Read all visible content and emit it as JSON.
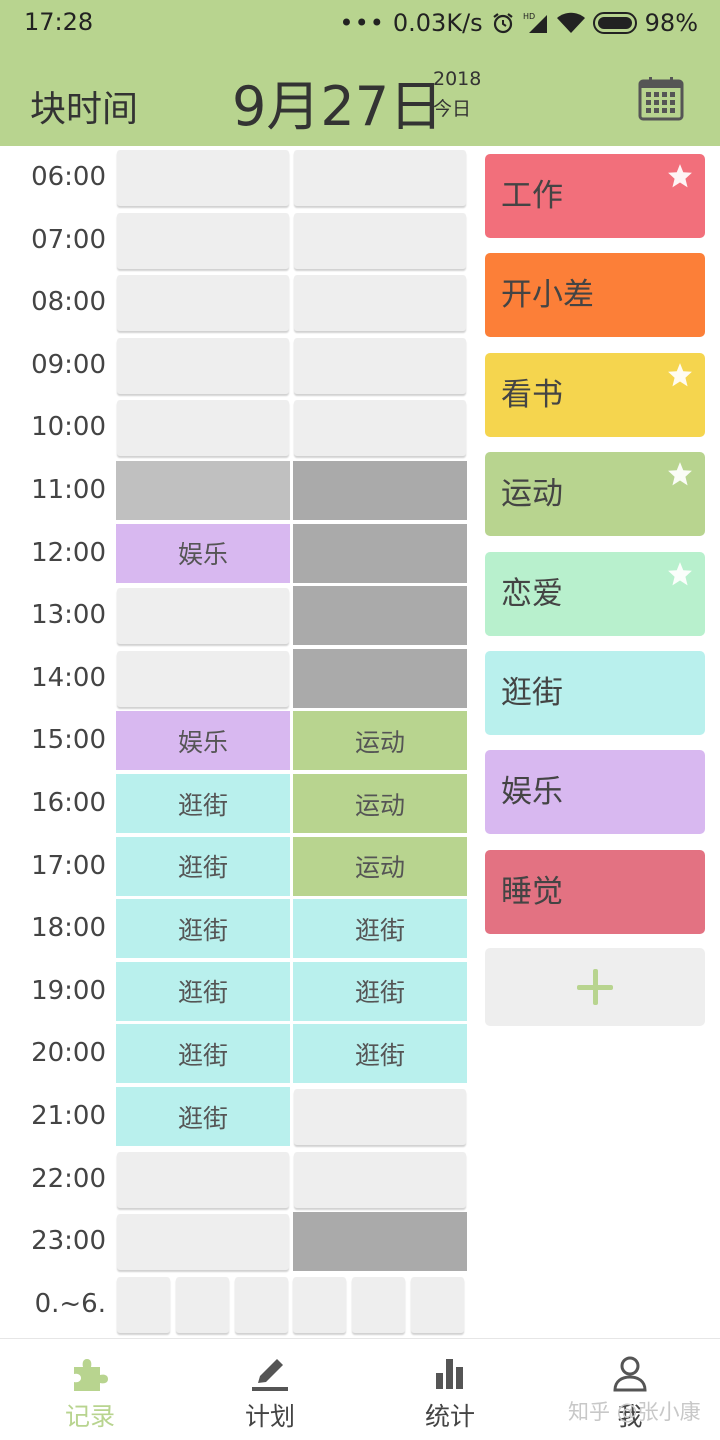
{
  "status_bar": {
    "time": "17:28",
    "dots": "•••",
    "net_speed": "0.03K/s",
    "battery": "98%",
    "icons": [
      "alarm-icon",
      "hd-signal-icon",
      "wifi-icon",
      "battery-icon"
    ]
  },
  "header": {
    "title": "块时间",
    "date": "9月27日",
    "year": "2018",
    "today": "今日",
    "calendar_icon": "calendar-icon"
  },
  "colors": {
    "theme_green": "#b8d48f",
    "empty": "#eeeeee",
    "blocked_light": "#c0c0c0",
    "blocked": "#aaaaaa",
    "work": "#f26f7b",
    "trip": "#fc7f38",
    "read": "#f5d54e",
    "sport": "#b8d48f",
    "love": "#b8f0cd",
    "shopping": "#b9f0ed",
    "fun": "#d8b8f0",
    "sleep": "#e37282"
  },
  "schedule": {
    "rows": [
      {
        "time": "06:00",
        "left": "",
        "right": ""
      },
      {
        "time": "07:00",
        "left": "",
        "right": ""
      },
      {
        "time": "08:00",
        "left": "",
        "right": ""
      },
      {
        "time": "09:00",
        "left": "",
        "right": ""
      },
      {
        "time": "10:00",
        "left": "",
        "right": ""
      },
      {
        "time": "11:00",
        "left": "",
        "right": ""
      },
      {
        "time": "12:00",
        "left": "娱乐",
        "right": ""
      },
      {
        "time": "13:00",
        "left": "",
        "right": ""
      },
      {
        "time": "14:00",
        "left": "",
        "right": ""
      },
      {
        "time": "15:00",
        "left": "娱乐",
        "right": "运动"
      },
      {
        "time": "16:00",
        "left": "逛街",
        "right": "运动"
      },
      {
        "time": "17:00",
        "left": "逛街",
        "right": "运动"
      },
      {
        "time": "18:00",
        "left": "逛街",
        "right": "逛街"
      },
      {
        "time": "19:00",
        "left": "逛街",
        "right": "逛街"
      },
      {
        "time": "20:00",
        "left": "逛街",
        "right": "逛街"
      },
      {
        "time": "21:00",
        "left": "逛街",
        "right": ""
      },
      {
        "time": "22:00",
        "left": "",
        "right": ""
      },
      {
        "time": "23:00",
        "left": "",
        "right": ""
      },
      {
        "time": "0.~6.",
        "left": "",
        "right": ""
      }
    ]
  },
  "categories": [
    {
      "label": "工作",
      "starred": true
    },
    {
      "label": "开小差",
      "starred": false
    },
    {
      "label": "看书",
      "starred": true
    },
    {
      "label": "运动",
      "starred": true
    },
    {
      "label": "恋爱",
      "starred": true
    },
    {
      "label": "逛街",
      "starred": false
    },
    {
      "label": "娱乐",
      "starred": false
    },
    {
      "label": "睡觉",
      "starred": false
    }
  ],
  "add_icon": "plus-icon",
  "bottom_nav": [
    {
      "label": "记录",
      "icon": "puzzle-icon",
      "active": true
    },
    {
      "label": "计划",
      "icon": "pencil-icon",
      "active": false
    },
    {
      "label": "统计",
      "icon": "bar-chart-icon",
      "active": false
    },
    {
      "label": "我",
      "icon": "user-icon",
      "active": false
    }
  ],
  "watermark": "知乎 @张小康"
}
